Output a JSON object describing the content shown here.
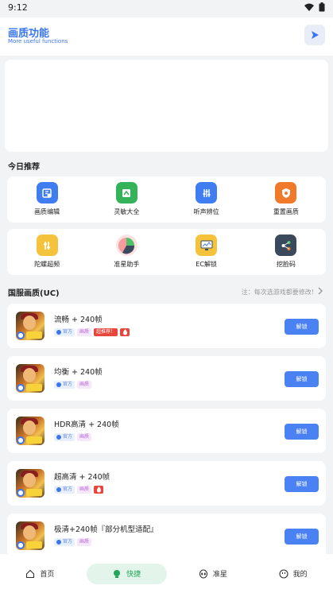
{
  "status": {
    "time": "9:12"
  },
  "header": {
    "title": "画质功能",
    "subtitle": "More useful functions"
  },
  "today": {
    "title": "今日推荐",
    "row1": [
      {
        "label": "画质编辑",
        "icon": "image-edit-icon",
        "color": "#3f7df1"
      },
      {
        "label": "灵敏大全",
        "icon": "sensitivity-icon",
        "color": "#35b35a"
      },
      {
        "label": "听声辨位",
        "icon": "equalizer-icon",
        "color": "#3f7df1"
      },
      {
        "label": "重置画质",
        "icon": "shield-icon",
        "color": "#f07a2a"
      }
    ],
    "row2": [
      {
        "label": "陀螺超频",
        "icon": "gyro-icon",
        "color": "#f5c33b"
      },
      {
        "label": "准星助手",
        "icon": "pie-chart-icon",
        "color": "#f2a0a0"
      },
      {
        "label": "EC解锁",
        "icon": "monitor-icon",
        "color": "#f5c33b"
      },
      {
        "label": "挖脸码",
        "icon": "share-icon",
        "color": "#3a4a5c"
      }
    ]
  },
  "quality": {
    "title": "国服画质(UC)",
    "note": "注：每次选游戏都要修改!",
    "tag_official": "官方",
    "tag_quality": "画质",
    "tag_recommend": "超推荐！",
    "button": "解锁",
    "items": [
      {
        "name": "流畅 + 240帧"
      },
      {
        "name": "均衡 + 240帧"
      },
      {
        "name": "HDR高清 + 240帧"
      },
      {
        "name": "超高清 + 240帧"
      },
      {
        "name": "极清+240帧『部分机型适配』"
      }
    ]
  },
  "tabs": [
    {
      "label": "首页",
      "icon": "home-icon"
    },
    {
      "label": "快捷",
      "icon": "lightbulb-icon"
    },
    {
      "label": "准星",
      "icon": "alien-icon"
    },
    {
      "label": "我的",
      "icon": "smiley-icon"
    }
  ]
}
